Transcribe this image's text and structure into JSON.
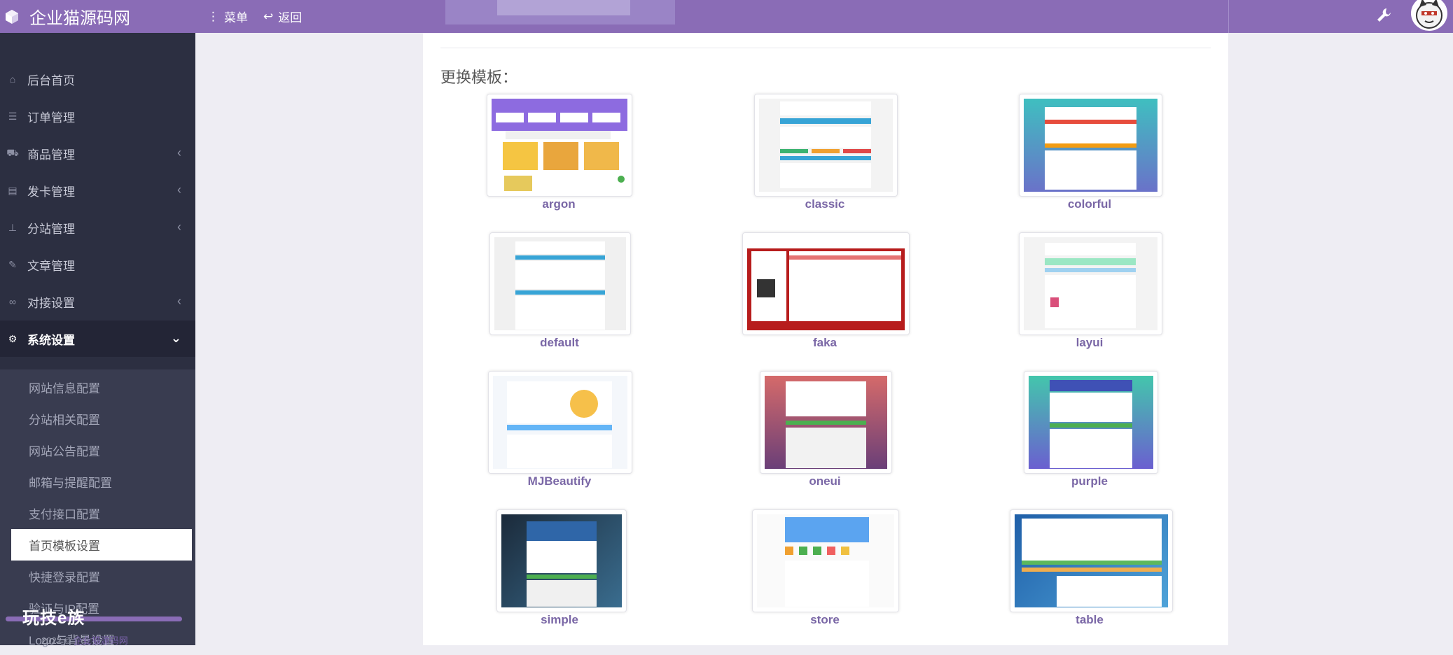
{
  "app": {
    "brand": "企业猫源码网"
  },
  "topbar": {
    "menu_label": "菜单",
    "back_label": "返回"
  },
  "sidebar": {
    "items": [
      {
        "label": "后台首页",
        "icon": "home-icon",
        "has_children": false
      },
      {
        "label": "订单管理",
        "icon": "list-icon",
        "has_children": false
      },
      {
        "label": "商品管理",
        "icon": "cart-icon",
        "has_children": true
      },
      {
        "label": "发卡管理",
        "icon": "card-icon",
        "has_children": true
      },
      {
        "label": "分站管理",
        "icon": "sitemap-icon",
        "has_children": true
      },
      {
        "label": "文章管理",
        "icon": "pencil-icon",
        "has_children": false
      },
      {
        "label": "对接设置",
        "icon": "link-icon",
        "has_children": true
      },
      {
        "label": "系统设置",
        "icon": "gear-icon",
        "has_children": true,
        "expanded": true
      }
    ],
    "submenu": [
      {
        "label": "网站信息配置"
      },
      {
        "label": "分站相关配置"
      },
      {
        "label": "网站公告配置"
      },
      {
        "label": "邮箱与提醒配置"
      },
      {
        "label": "支付接口配置"
      },
      {
        "label": "首页模板设置",
        "selected": true
      },
      {
        "label": "快捷登录配置"
      },
      {
        "label": "验证与IP配置"
      },
      {
        "label": "Logo与背景设置"
      }
    ],
    "copyright_year": "2022 ©",
    "copyright_link": "企业猫源码网",
    "watermark": "玩技e族"
  },
  "main": {
    "section_title": "更换模板：",
    "templates": [
      {
        "name": "argon"
      },
      {
        "name": "classic"
      },
      {
        "name": "colorful"
      },
      {
        "name": "default"
      },
      {
        "name": "faka"
      },
      {
        "name": "layui"
      },
      {
        "name": "MJBeautify"
      },
      {
        "name": "oneui"
      },
      {
        "name": "purple"
      },
      {
        "name": "simple"
      },
      {
        "name": "store"
      },
      {
        "name": "table"
      }
    ]
  },
  "colors": {
    "accent": "#8a6cb6",
    "sidebar_bg": "#2c2f41",
    "submenu_bg": "#393c50",
    "page_bg": "#eeedf3",
    "template_label": "#7a67a6"
  }
}
